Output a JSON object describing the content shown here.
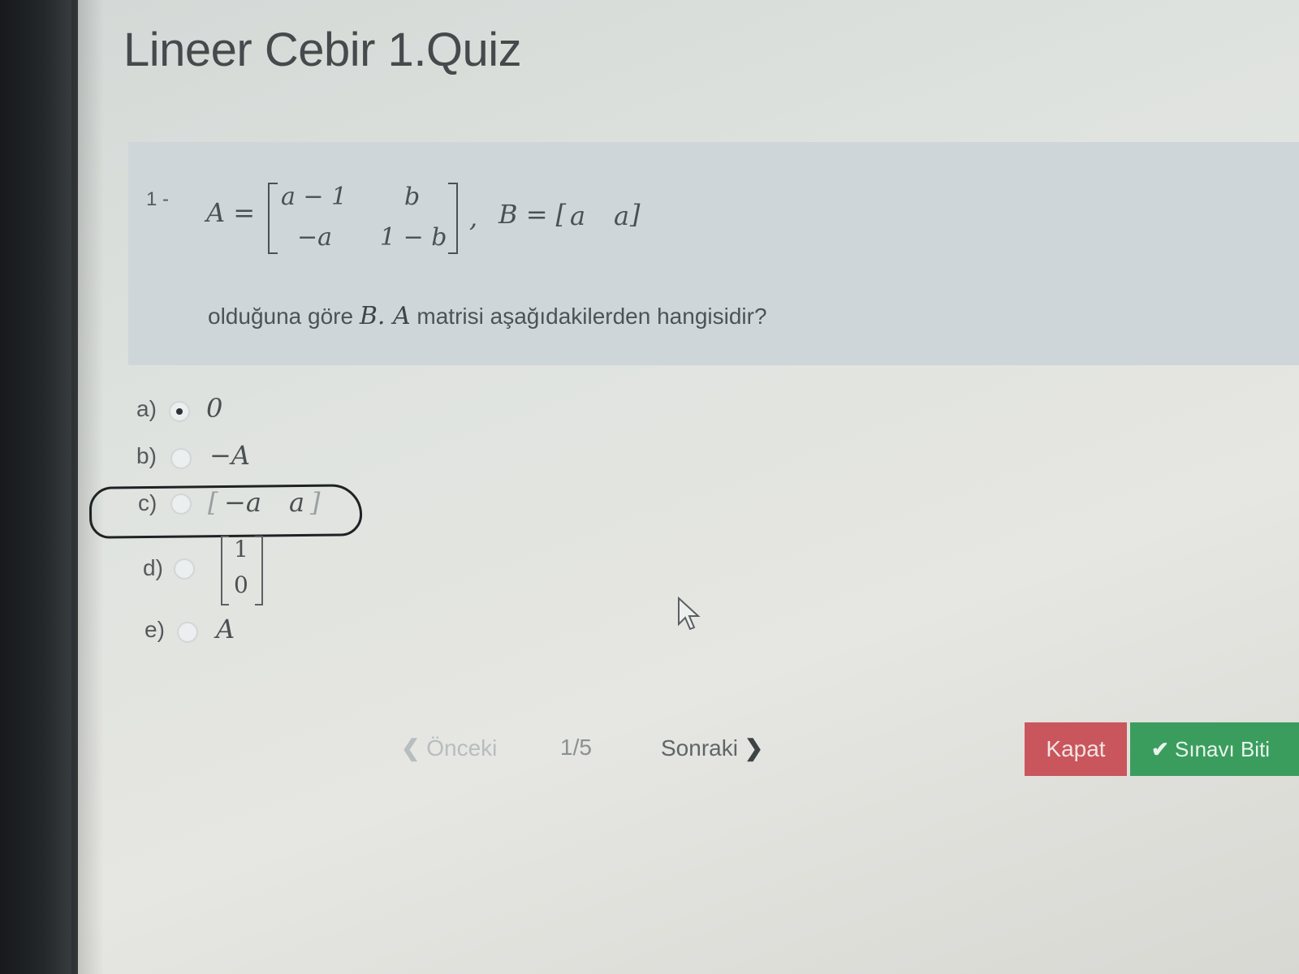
{
  "quiz": {
    "title": "Lineer Cebir 1.Quiz"
  },
  "question": {
    "number": "1 -",
    "matrix_A_label": "A =",
    "matrix_A": {
      "r1c1": "a − 1",
      "r1c2": "b",
      "r2c1": "−a",
      "r2c2": "1 − b"
    },
    "separator": ",",
    "matrix_B_label": "B = [",
    "matrix_B": {
      "c1": "a",
      "c2": "a",
      "close": "]"
    },
    "text_before": "olduğuna göre ",
    "text_math": "B. A",
    "text_after": " matrisi aşağıdakilerden hangisidir?"
  },
  "options": [
    {
      "letter": "a)",
      "value": "0",
      "selected": true
    },
    {
      "letter": "b)",
      "value": "−A",
      "selected": false
    },
    {
      "letter": "c)",
      "value": "[−a   a]",
      "selected": false,
      "open": "[",
      "v1": "−a",
      "v2": "a",
      "close": "]"
    },
    {
      "letter": "d)",
      "value": "column",
      "selected": false,
      "top": "1",
      "bottom": "0"
    },
    {
      "letter": "e)",
      "value": "A",
      "selected": false
    }
  ],
  "navigation": {
    "prev_label": "Önceki",
    "page_indicator": "1/5",
    "next_label": "Sonraki"
  },
  "actions": {
    "close_label": "Kapat",
    "finish_label": "Sınavı Biti"
  },
  "colors": {
    "close_button": "#c9565c",
    "finish_button": "#3a9d5e",
    "question_background": "#cfd6d9"
  }
}
